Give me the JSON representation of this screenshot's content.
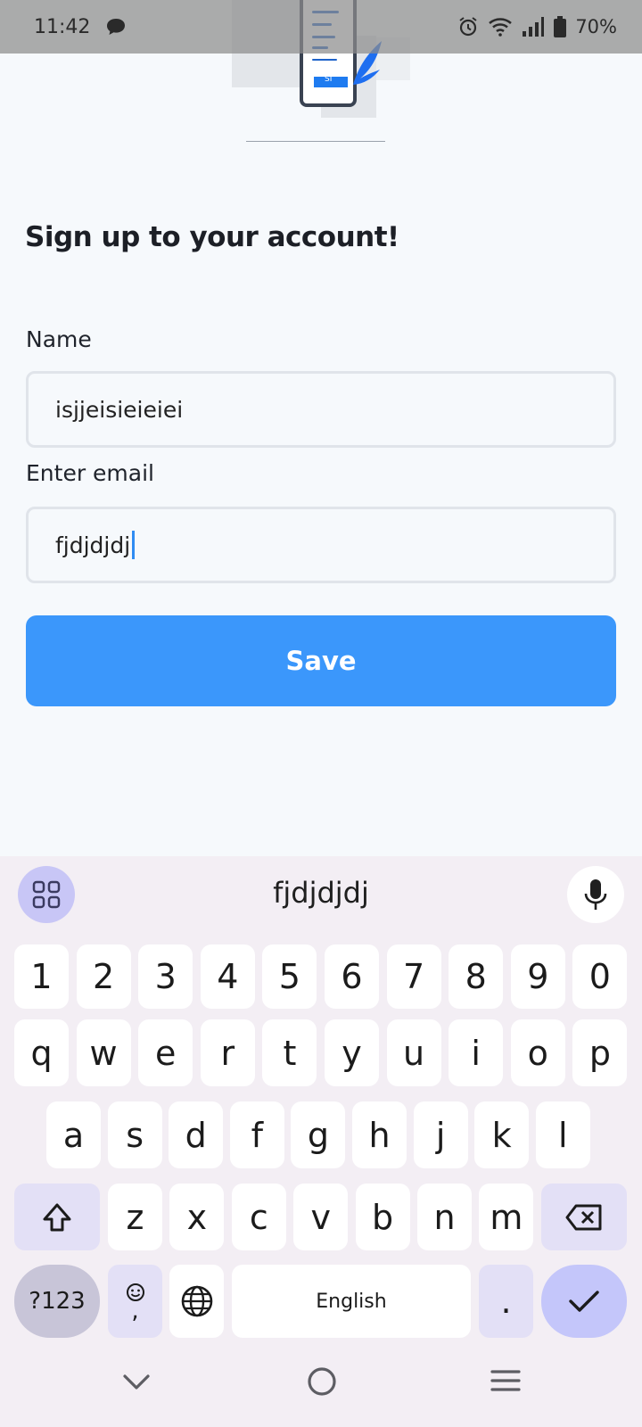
{
  "status_bar": {
    "time": "11:42",
    "battery": "70%",
    "icons": [
      "chat-bubble-icon",
      "alarm-icon",
      "wifi-icon",
      "signal-icon",
      "battery-icon"
    ]
  },
  "illustration": {
    "phone_button_text": "SI"
  },
  "form": {
    "title": "Sign up to your account!",
    "name_label": "Name",
    "name_value": "isjjeisieieiei",
    "email_label": "Enter email",
    "email_value": "fjdjdjdj",
    "save_label": "Save"
  },
  "keyboard": {
    "suggestion": "fjdjdjdj",
    "row_numbers": [
      "1",
      "2",
      "3",
      "4",
      "5",
      "6",
      "7",
      "8",
      "9",
      "0"
    ],
    "row_top": [
      "q",
      "w",
      "e",
      "r",
      "t",
      "y",
      "u",
      "i",
      "o",
      "p"
    ],
    "row_mid": [
      "a",
      "s",
      "d",
      "f",
      "g",
      "h",
      "j",
      "k",
      "l"
    ],
    "row_bottom": [
      "z",
      "x",
      "c",
      "v",
      "b",
      "n",
      "m"
    ],
    "symbols_label": "?123",
    "emoji_comma": ",",
    "space_label": "English",
    "period_label": "."
  },
  "colors": {
    "accent": "#3b97fb",
    "background": "#f6f9fc",
    "keyboard_bg": "#f3eef4"
  }
}
